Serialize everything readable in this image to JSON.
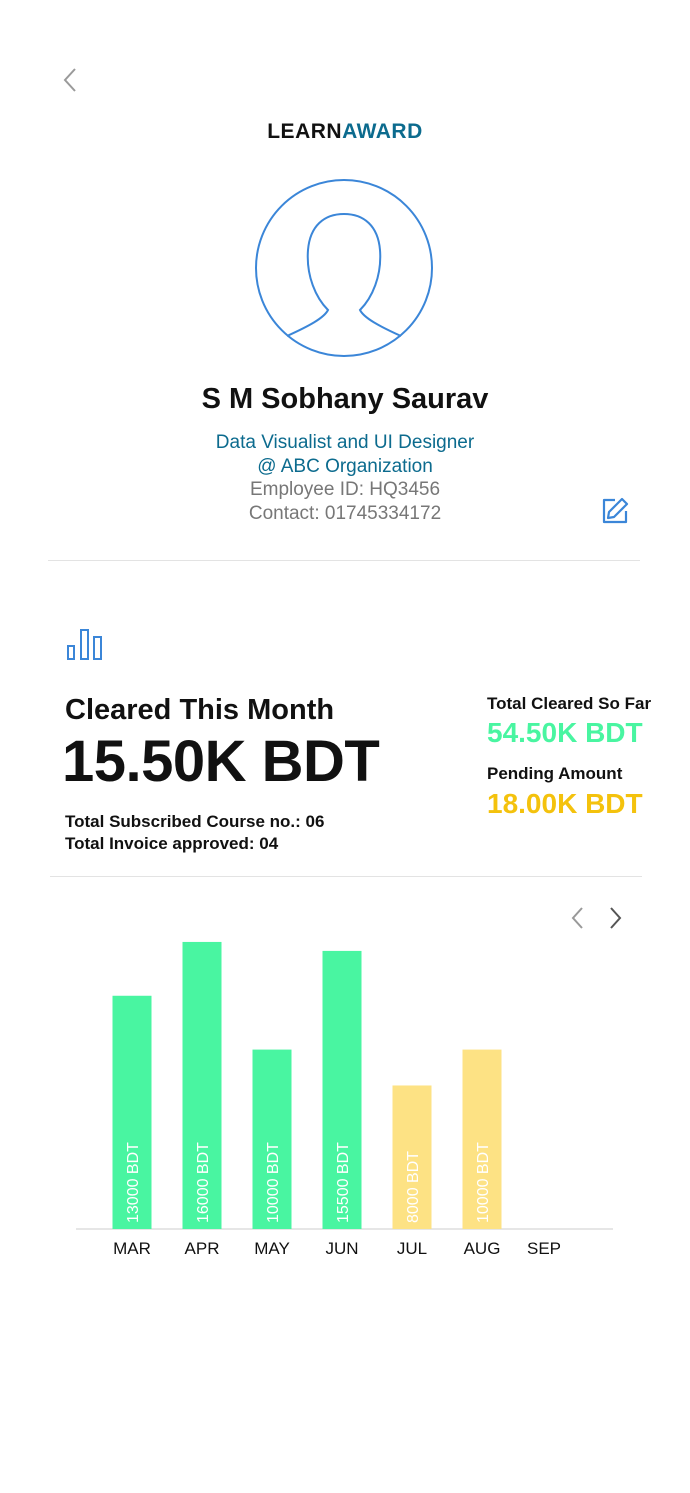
{
  "header": {
    "back_icon": "chevron-left-icon",
    "brand_part1": "LEARN",
    "brand_part2": "AWARD"
  },
  "profile": {
    "avatar_icon": "user-avatar-icon",
    "name": "S M Sobhany Saurav",
    "role": "Data Visualist and UI Designer",
    "organization": "@ ABC Organization",
    "employee_id": "Employee ID: HQ3456",
    "contact": "Contact: 01745334172",
    "edit_icon": "edit-icon"
  },
  "summary": {
    "icon": "bar-chart-icon",
    "cleared_label": "Cleared This Month",
    "cleared_value": "15.50K BDT",
    "subscribed_courses": "Total Subscribed Course no.: 06",
    "invoices_approved": "Total Invoice approved: 04",
    "total_cleared_label": "Total Cleared So Far",
    "total_cleared_value": "54.50K BDT",
    "pending_label": "Pending Amount",
    "pending_value": "18.00K BDT"
  },
  "colors": {
    "brand_blue": "#0c6b8e",
    "outline_blue": "#3b86d8",
    "cleared_green": "#49f5a1",
    "pending_yellow": "#fde284",
    "pending_text": "#f4c20d"
  },
  "chart_nav": {
    "prev_icon": "chevron-left-icon",
    "next_icon": "chevron-right-icon"
  },
  "chart_data": {
    "type": "bar",
    "categories": [
      "MAR",
      "APR",
      "MAY",
      "JUN",
      "JUL",
      "AUG",
      "SEP"
    ],
    "values": [
      13000,
      16000,
      10000,
      15500,
      8000,
      10000,
      null
    ],
    "labels": [
      "13000 BDT",
      "16000 BDT",
      "10000 BDT",
      "15500 BDT",
      "8000 BDT",
      "10000 BDT",
      ""
    ],
    "status": [
      "cleared",
      "cleared",
      "cleared",
      "cleared",
      "pending",
      "pending",
      "none"
    ],
    "title": "",
    "xlabel": "",
    "ylabel": "",
    "ylim": [
      0,
      17000
    ],
    "grid": false
  }
}
